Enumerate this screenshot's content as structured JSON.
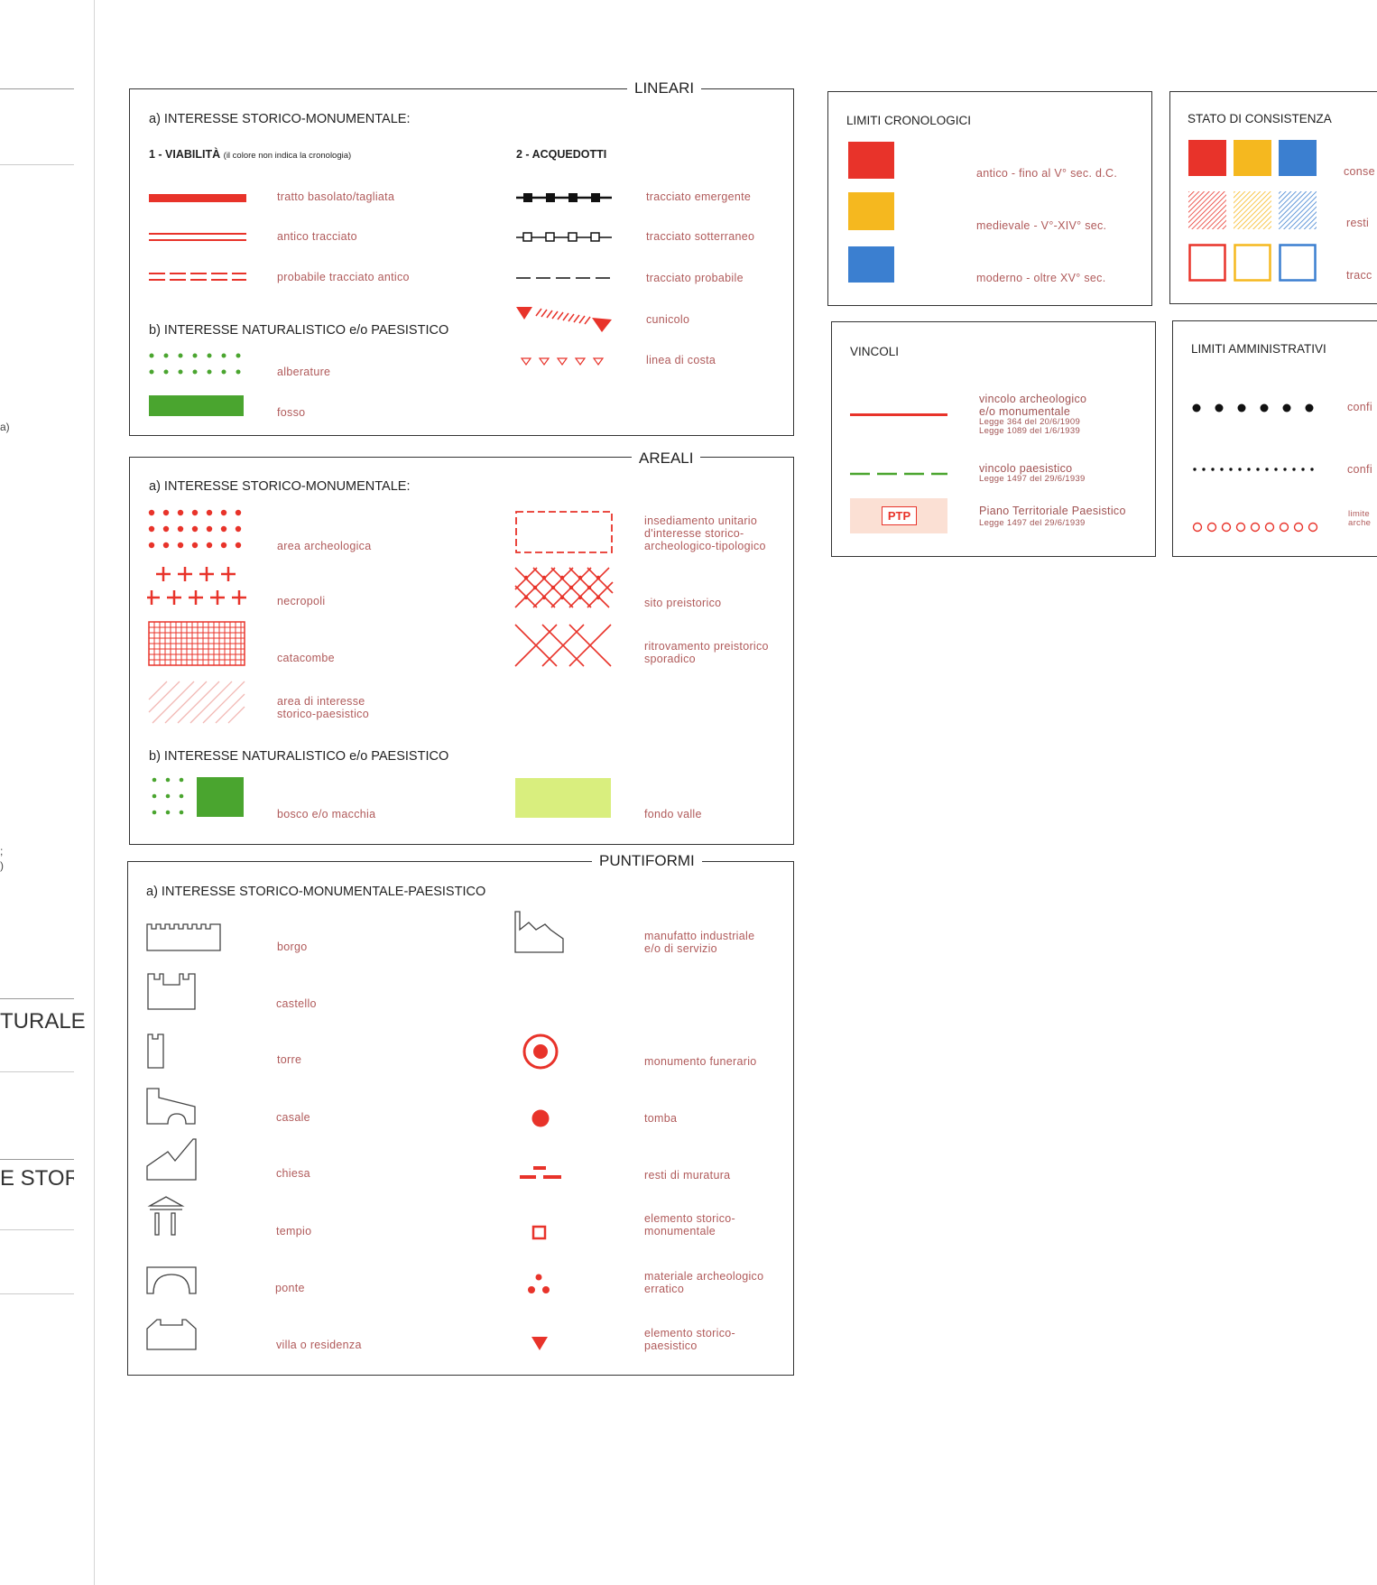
{
  "left_panel": {
    "frag_a": "a)",
    "frag_b": ";",
    "frag_c": ")",
    "heading1": "TURALE",
    "heading2": "E STORI("
  },
  "lineari": {
    "title": "LINEARI",
    "sec_a": "a) INTERESSE STORICO-MONUMENTALE:",
    "viabilita": "1 - VIABILITÀ",
    "viabilita_note": "(il colore non indica la cronologia)",
    "acquedotti": "2 - ACQUEDOTTI",
    "items_left": [
      "tratto basolato/tagliata",
      "antico tracciato",
      "probabile tracciato antico"
    ],
    "items_right": [
      "tracciato emergente",
      "tracciato sotterraneo",
      "tracciato probabile",
      "cunicolo",
      "linea di costa"
    ],
    "sec_b": "b) INTERESSE NATURALISTICO e/o PAESISTICO",
    "items_b": [
      "alberature",
      "fosso"
    ]
  },
  "areali": {
    "title": "AREALI",
    "sec_a": "a) INTERESSE STORICO-MONUMENTALE:",
    "items_left": [
      "area archeologica",
      "necropoli",
      "catacombe",
      "area di interesse",
      "storico-paesistico"
    ],
    "items_right": [
      "insediamento unitario",
      "d'interesse storico-",
      "archeologico-tipologico",
      "sito preistorico",
      "ritrovamento preistorico",
      "sporadico"
    ],
    "sec_b": "b) INTERESSE NATURALISTICO e/o PAESISTICO",
    "items_b": [
      "bosco e/o macchia",
      "fondo valle"
    ]
  },
  "puntiformi": {
    "title": "PUNTIFORMI",
    "sec_a": "a) INTERESSE STORICO-MONUMENTALE-PAESISTICO",
    "items_left": [
      "borgo",
      "castello",
      "torre",
      "casale",
      "chiesa",
      "tempio",
      "ponte",
      "villa o residenza"
    ],
    "items_right": [
      "manufatto industriale",
      "e/o di servizio",
      "monumento funerario",
      "tomba",
      "resti di muratura",
      "elemento storico-",
      "monumentale",
      "materiale archeologico",
      "erratico",
      "elemento storico-",
      "paesistico"
    ]
  },
  "limiti_cronologici": {
    "title": "LIMITI CRONOLOGICI",
    "items": [
      "antico - fino al V° sec. d.C.",
      "medievale - V°-XIV° sec.",
      "moderno - oltre XV° sec."
    ],
    "colors": [
      "#e8332a",
      "#f5b81f",
      "#3b7fd0"
    ]
  },
  "stato_consistenza": {
    "title": "STATO DI CONSISTENZA",
    "items": [
      "conse",
      "resti",
      "tracc"
    ]
  },
  "vincoli": {
    "title": "VINCOLI",
    "items": [
      [
        "vincolo archeologico",
        "e/o monumentale",
        "Legge 364 del 20/6/1909",
        "Legge 1089 del 1/6/1939"
      ],
      [
        "vincolo paesistico",
        "Legge 1497 del 29/6/1939"
      ],
      [
        "Piano Territoriale Paesistico",
        "Legge 1497 del 29/6/1939"
      ]
    ],
    "ptp": "PTP"
  },
  "limiti_amministrativi": {
    "title": "LIMITI AMMINISTRATIVI",
    "items": [
      "confi",
      "confi",
      "limite",
      "arche"
    ]
  }
}
